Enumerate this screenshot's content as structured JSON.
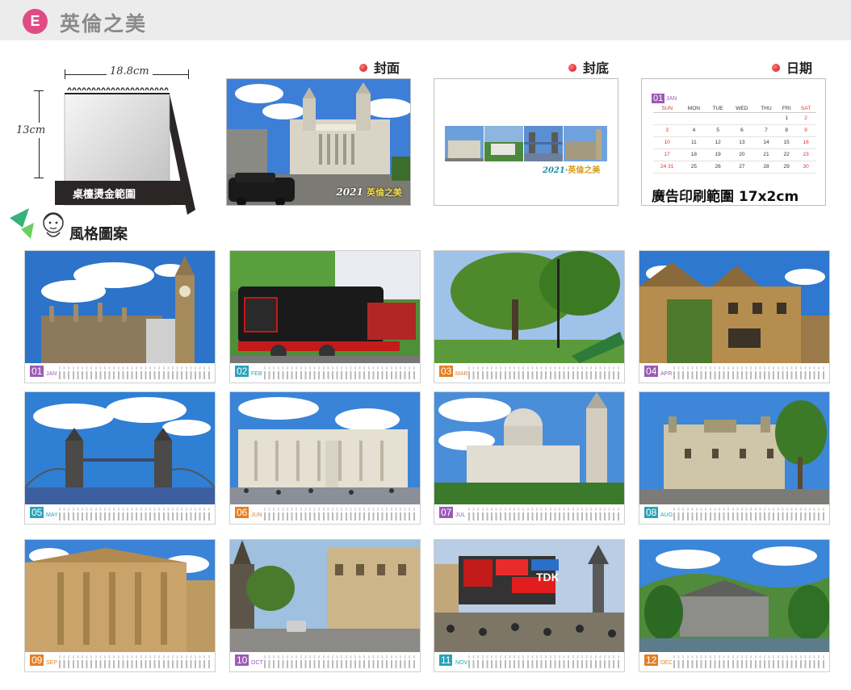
{
  "header": {
    "badge": "E",
    "title": "英倫之美"
  },
  "desk_calendar": {
    "width_label": "18.8cm",
    "height_label": "13cm",
    "print_area": "桌檯燙金範圍"
  },
  "sections": {
    "cover": "封面",
    "back": "封底",
    "calendar": "日期"
  },
  "cover_caption": {
    "year": "2021",
    "name": "英倫之美"
  },
  "back_caption": {
    "year": "2021",
    "name": "英倫之美"
  },
  "calendar_preview": {
    "month_num": "01",
    "month_name": "JAN",
    "weekdays": [
      "SUN",
      "MON",
      "TUE",
      "WED",
      "THU",
      "FRI",
      "SAT"
    ],
    "rows": [
      [
        "",
        "",
        "",
        "",
        "",
        "1",
        "2"
      ],
      [
        "3",
        "4",
        "5",
        "6",
        "7",
        "8",
        "9"
      ],
      [
        "10",
        "11",
        "12",
        "13",
        "14",
        "15",
        "16"
      ],
      [
        "17",
        "18",
        "19",
        "20",
        "21",
        "22",
        "23"
      ],
      [
        "24 31",
        "25",
        "26",
        "27",
        "28",
        "29",
        "30"
      ]
    ],
    "ad_area": "廣告印刷範圍 17x2cm"
  },
  "style_label": "風格圖案",
  "months": [
    {
      "num": "01",
      "name": "JAN",
      "color": "#9b59b6",
      "scene": "parliament"
    },
    {
      "num": "02",
      "name": "FEB",
      "color": "#29a3b8",
      "scene": "train"
    },
    {
      "num": "03",
      "name": "MAR",
      "color": "#e67e22",
      "scene": "park"
    },
    {
      "num": "04",
      "name": "APR",
      "color": "#9b59b6",
      "scene": "cottage"
    },
    {
      "num": "05",
      "name": "MAY",
      "color": "#29a3b8",
      "scene": "towerbridge"
    },
    {
      "num": "06",
      "name": "JUN",
      "color": "#e67e22",
      "scene": "palace"
    },
    {
      "num": "07",
      "name": "JUL",
      "color": "#9b59b6",
      "scene": "stpauls"
    },
    {
      "num": "08",
      "name": "AUG",
      "color": "#29a3b8",
      "scene": "castle"
    },
    {
      "num": "09",
      "name": "SEP",
      "color": "#e67e22",
      "scene": "blenheim"
    },
    {
      "num": "10",
      "name": "OCT",
      "color": "#9b59b6",
      "scene": "oxford"
    },
    {
      "num": "11",
      "name": "NOV",
      "color": "#29a3b8",
      "scene": "piccadilly"
    },
    {
      "num": "12",
      "name": "DEC",
      "color": "#e67e22",
      "scene": "lakes"
    }
  ],
  "piccadilly_sign": "TDK"
}
